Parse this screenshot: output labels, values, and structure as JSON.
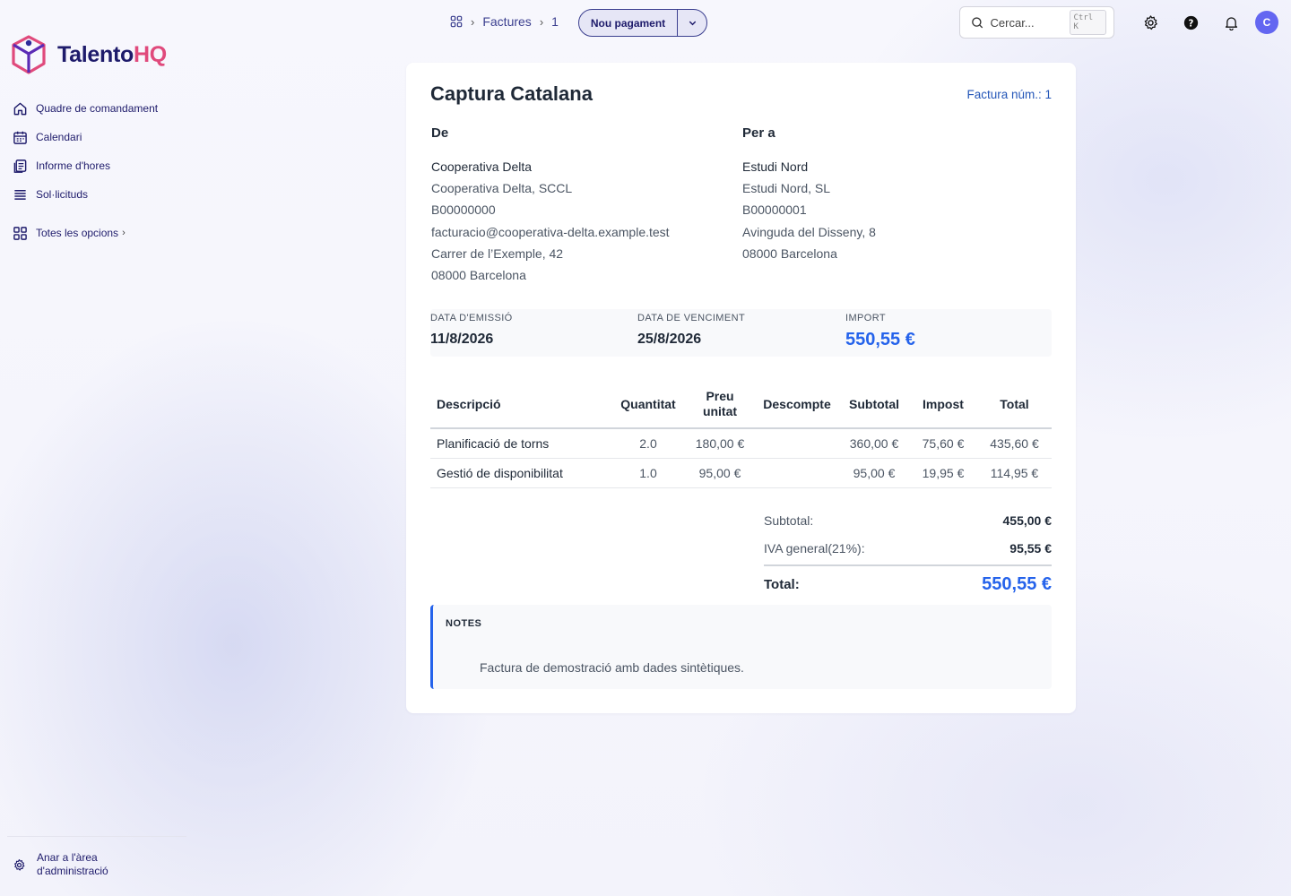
{
  "app": {
    "brand_main": "Talento",
    "brand_accent": "HQ",
    "brand_color": "#1e1b6b",
    "accent_color": "#e04a7c",
    "link_color": "#2563eb"
  },
  "sidebar": {
    "items": [
      {
        "label": "Quadre de comandament",
        "icon": "home-icon"
      },
      {
        "label": "Calendari",
        "icon": "calendar-icon"
      },
      {
        "label": "Informe d'hores",
        "icon": "report-icon"
      },
      {
        "label": "Sol·licituds",
        "icon": "list-icon"
      }
    ],
    "more_label": "Totes les opcions",
    "admin_label": "Anar a l'àrea d'administració"
  },
  "topbar": {
    "breadcrumb": [
      "Factures",
      "1"
    ],
    "primary_action": "Nou pagament",
    "search_placeholder": "Cercar...",
    "search_shortcut": "Ctrl K",
    "avatar_initial": "C"
  },
  "invoice": {
    "title": "Captura Catalana",
    "number_label": "Factura núm.: 1",
    "from": {
      "heading": "De",
      "name": "Cooperativa Delta",
      "lines": [
        "Cooperativa Delta, SCCL",
        "B00000000",
        "facturacio@cooperativa-delta.example.test",
        "Carrer de l’Exemple, 42",
        "08000 Barcelona"
      ]
    },
    "to": {
      "heading": "Per a",
      "name": "Estudi Nord",
      "lines": [
        "Estudi Nord, SL",
        "B00000001",
        "Avinguda del Disseny, 8",
        "08000 Barcelona"
      ]
    },
    "meta": {
      "issue_label": "DATA D'EMISSIÓ",
      "issue_value": "11/8/2026",
      "due_label": "DATA DE VENCIMENT",
      "due_value": "25/8/2026",
      "amount_label": "IMPORT",
      "amount_value": "550,55 €"
    },
    "table": {
      "headers": [
        "Descripció",
        "Quantitat",
        "Preu unitat",
        "Descompte",
        "Subtotal",
        "Impost",
        "Total"
      ],
      "rows": [
        [
          "Planificació de torns",
          "2.0",
          "180,00 €",
          "",
          "360,00 €",
          "75,60 €",
          "435,60 €"
        ],
        [
          "Gestió de disponibilitat",
          "1.0",
          "95,00 €",
          "",
          "95,00 €",
          "19,95 €",
          "114,95 €"
        ]
      ]
    },
    "totals": {
      "subtotal_label": "Subtotal:",
      "subtotal_value": "455,00 €",
      "tax_label": "IVA general(21%):",
      "tax_value": "95,55 €",
      "total_label": "Total:",
      "total_value": "550,55 €"
    },
    "notes": {
      "label": "NOTES",
      "text": "Factura de demostració amb dades sintètiques."
    }
  }
}
